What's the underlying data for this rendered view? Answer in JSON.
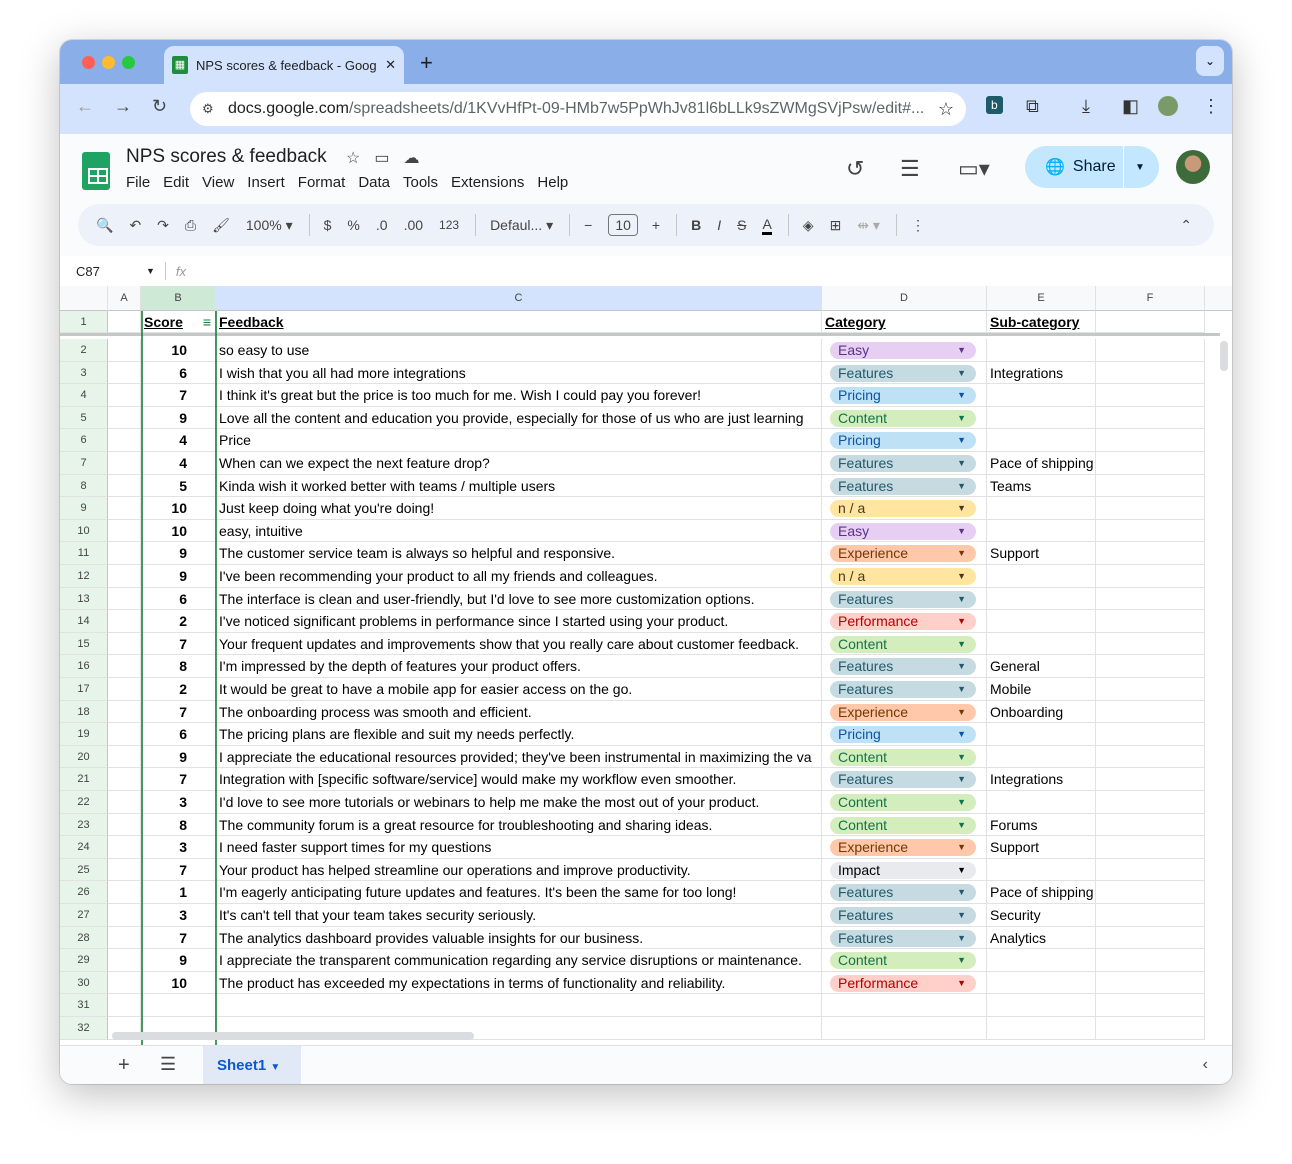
{
  "browser": {
    "tab_title": "NPS scores & feedback - Google Sheets",
    "url_host": "docs.google.com",
    "url_path": "/spreadsheets/d/1KVvHfPt-09-HMb7w5PpWhJv81l6bLLk9sZWMgSVjPsw/edit#..."
  },
  "doc": {
    "title": "NPS scores & feedback",
    "menu": [
      "File",
      "Edit",
      "View",
      "Insert",
      "Format",
      "Data",
      "Tools",
      "Extensions",
      "Help"
    ],
    "share_label": "Share"
  },
  "toolbar": {
    "zoom": "100%",
    "currency": "$",
    "percent": "%",
    "dec_less": ".0",
    "dec_more": ".00",
    "number_format": "123",
    "font": "Defaul...",
    "font_size": "10",
    "bold": "B",
    "italic": "I",
    "strike": "S",
    "text_color": "A"
  },
  "formula_bar": {
    "cell_ref": "C87",
    "fx": "fx"
  },
  "columns": [
    "A",
    "B",
    "C",
    "D",
    "E",
    "F"
  ],
  "header_row": {
    "score": "Score",
    "feedback": "Feedback",
    "category": "Category",
    "subcategory": "Sub-category"
  },
  "category_colors": {
    "Easy": {
      "bg": "#e6cff2",
      "fg": "#5a3286"
    },
    "Features": {
      "bg": "#c6dbe1",
      "fg": "#215a6c"
    },
    "Pricing": {
      "bg": "#bfe1f6",
      "fg": "#0a53a8"
    },
    "Content": {
      "bg": "#d4edbc",
      "fg": "#11734b"
    },
    "n / a": {
      "bg": "#ffe5a0",
      "fg": "#473821"
    },
    "Experience": {
      "bg": "#ffc8aa",
      "fg": "#753800"
    },
    "Performance": {
      "bg": "#ffcfc9",
      "fg": "#b10202"
    },
    "Impact": {
      "bg": "#e8eaed",
      "fg": "#000000"
    }
  },
  "rows": [
    {
      "n": "2",
      "score": "10",
      "feedback": "so easy to use",
      "category": "Easy",
      "sub": ""
    },
    {
      "n": "3",
      "score": "6",
      "feedback": "I wish that you all had more integrations",
      "category": "Features",
      "sub": "Integrations"
    },
    {
      "n": "4",
      "score": "7",
      "feedback": "I think it's great but the price is too much for me. Wish I could pay you forever!",
      "category": "Pricing",
      "sub": ""
    },
    {
      "n": "5",
      "score": "9",
      "feedback": "Love all the content and education you provide, especially for those of us who are just learning",
      "category": "Content",
      "sub": ""
    },
    {
      "n": "6",
      "score": "4",
      "feedback": "Price",
      "category": "Pricing",
      "sub": ""
    },
    {
      "n": "7",
      "score": "4",
      "feedback": "When can we expect the next feature drop?",
      "category": "Features",
      "sub": "Pace of shipping"
    },
    {
      "n": "8",
      "score": "5",
      "feedback": "Kinda wish it worked better with teams / multiple users",
      "category": "Features",
      "sub": "Teams"
    },
    {
      "n": "9",
      "score": "10",
      "feedback": "Just keep doing what you're doing!",
      "category": "n / a",
      "sub": ""
    },
    {
      "n": "10",
      "score": "10",
      "feedback": "easy, intuitive",
      "category": "Easy",
      "sub": ""
    },
    {
      "n": "11",
      "score": "9",
      "feedback": "The customer service team is always so helpful and responsive.",
      "category": "Experience",
      "sub": "Support"
    },
    {
      "n": "12",
      "score": "9",
      "feedback": "I've been recommending your product to all my friends and colleagues.",
      "category": "n / a",
      "sub": ""
    },
    {
      "n": "13",
      "score": "6",
      "feedback": "The interface is clean and user-friendly, but I'd love to see more customization options.",
      "category": "Features",
      "sub": ""
    },
    {
      "n": "14",
      "score": "2",
      "feedback": "I've noticed significant problems in performance since I started using your product.",
      "category": "Performance",
      "sub": ""
    },
    {
      "n": "15",
      "score": "7",
      "feedback": "Your frequent updates and improvements show that you really care about customer feedback.",
      "category": "Content",
      "sub": ""
    },
    {
      "n": "16",
      "score": "8",
      "feedback": "I'm impressed by the depth of features your product offers.",
      "category": "Features",
      "sub": "General"
    },
    {
      "n": "17",
      "score": "2",
      "feedback": "It would be great to have a mobile app for easier access on the go.",
      "category": "Features",
      "sub": "Mobile"
    },
    {
      "n": "18",
      "score": "7",
      "feedback": "The onboarding process was smooth and efficient.",
      "category": "Experience",
      "sub": "Onboarding"
    },
    {
      "n": "19",
      "score": "6",
      "feedback": "The pricing plans are flexible and suit my needs perfectly.",
      "category": "Pricing",
      "sub": ""
    },
    {
      "n": "20",
      "score": "9",
      "feedback": "I appreciate the educational resources provided; they've been instrumental in maximizing the va",
      "category": "Content",
      "sub": ""
    },
    {
      "n": "21",
      "score": "7",
      "feedback": "Integration with [specific software/service] would make my workflow even smoother.",
      "category": "Features",
      "sub": "Integrations"
    },
    {
      "n": "22",
      "score": "3",
      "feedback": "I'd love to see more tutorials or webinars to help me make the most out of your product.",
      "category": "Content",
      "sub": ""
    },
    {
      "n": "23",
      "score": "8",
      "feedback": "The community forum is a great resource for troubleshooting and sharing ideas.",
      "category": "Content",
      "sub": "Forums"
    },
    {
      "n": "24",
      "score": "3",
      "feedback": "I need faster support times for my questions",
      "category": "Experience",
      "sub": "Support"
    },
    {
      "n": "25",
      "score": "7",
      "feedback": "Your product has helped streamline our operations and improve productivity.",
      "category": "Impact",
      "sub": ""
    },
    {
      "n": "26",
      "score": "1",
      "feedback": "I'm eagerly anticipating future updates and features. It's been the same for too long!",
      "category": "Features",
      "sub": "Pace of shipping"
    },
    {
      "n": "27",
      "score": "3",
      "feedback": "It's can't tell that your team takes security seriously.",
      "category": "Features",
      "sub": "Security"
    },
    {
      "n": "28",
      "score": "7",
      "feedback": "The analytics dashboard provides valuable insights for our business.",
      "category": "Features",
      "sub": "Analytics"
    },
    {
      "n": "29",
      "score": "9",
      "feedback": "I appreciate the transparent communication regarding any service disruptions or maintenance.",
      "category": "Content",
      "sub": ""
    },
    {
      "n": "30",
      "score": "10",
      "feedback": "The product has exceeded my expectations in terms of functionality and reliability.",
      "category": "Performance",
      "sub": ""
    },
    {
      "n": "31",
      "score": "",
      "feedback": "",
      "category": "",
      "sub": ""
    },
    {
      "n": "32",
      "score": "",
      "feedback": "",
      "category": "",
      "sub": ""
    }
  ],
  "sheet_tabs": [
    {
      "label": "Sheet1",
      "active": true
    }
  ]
}
